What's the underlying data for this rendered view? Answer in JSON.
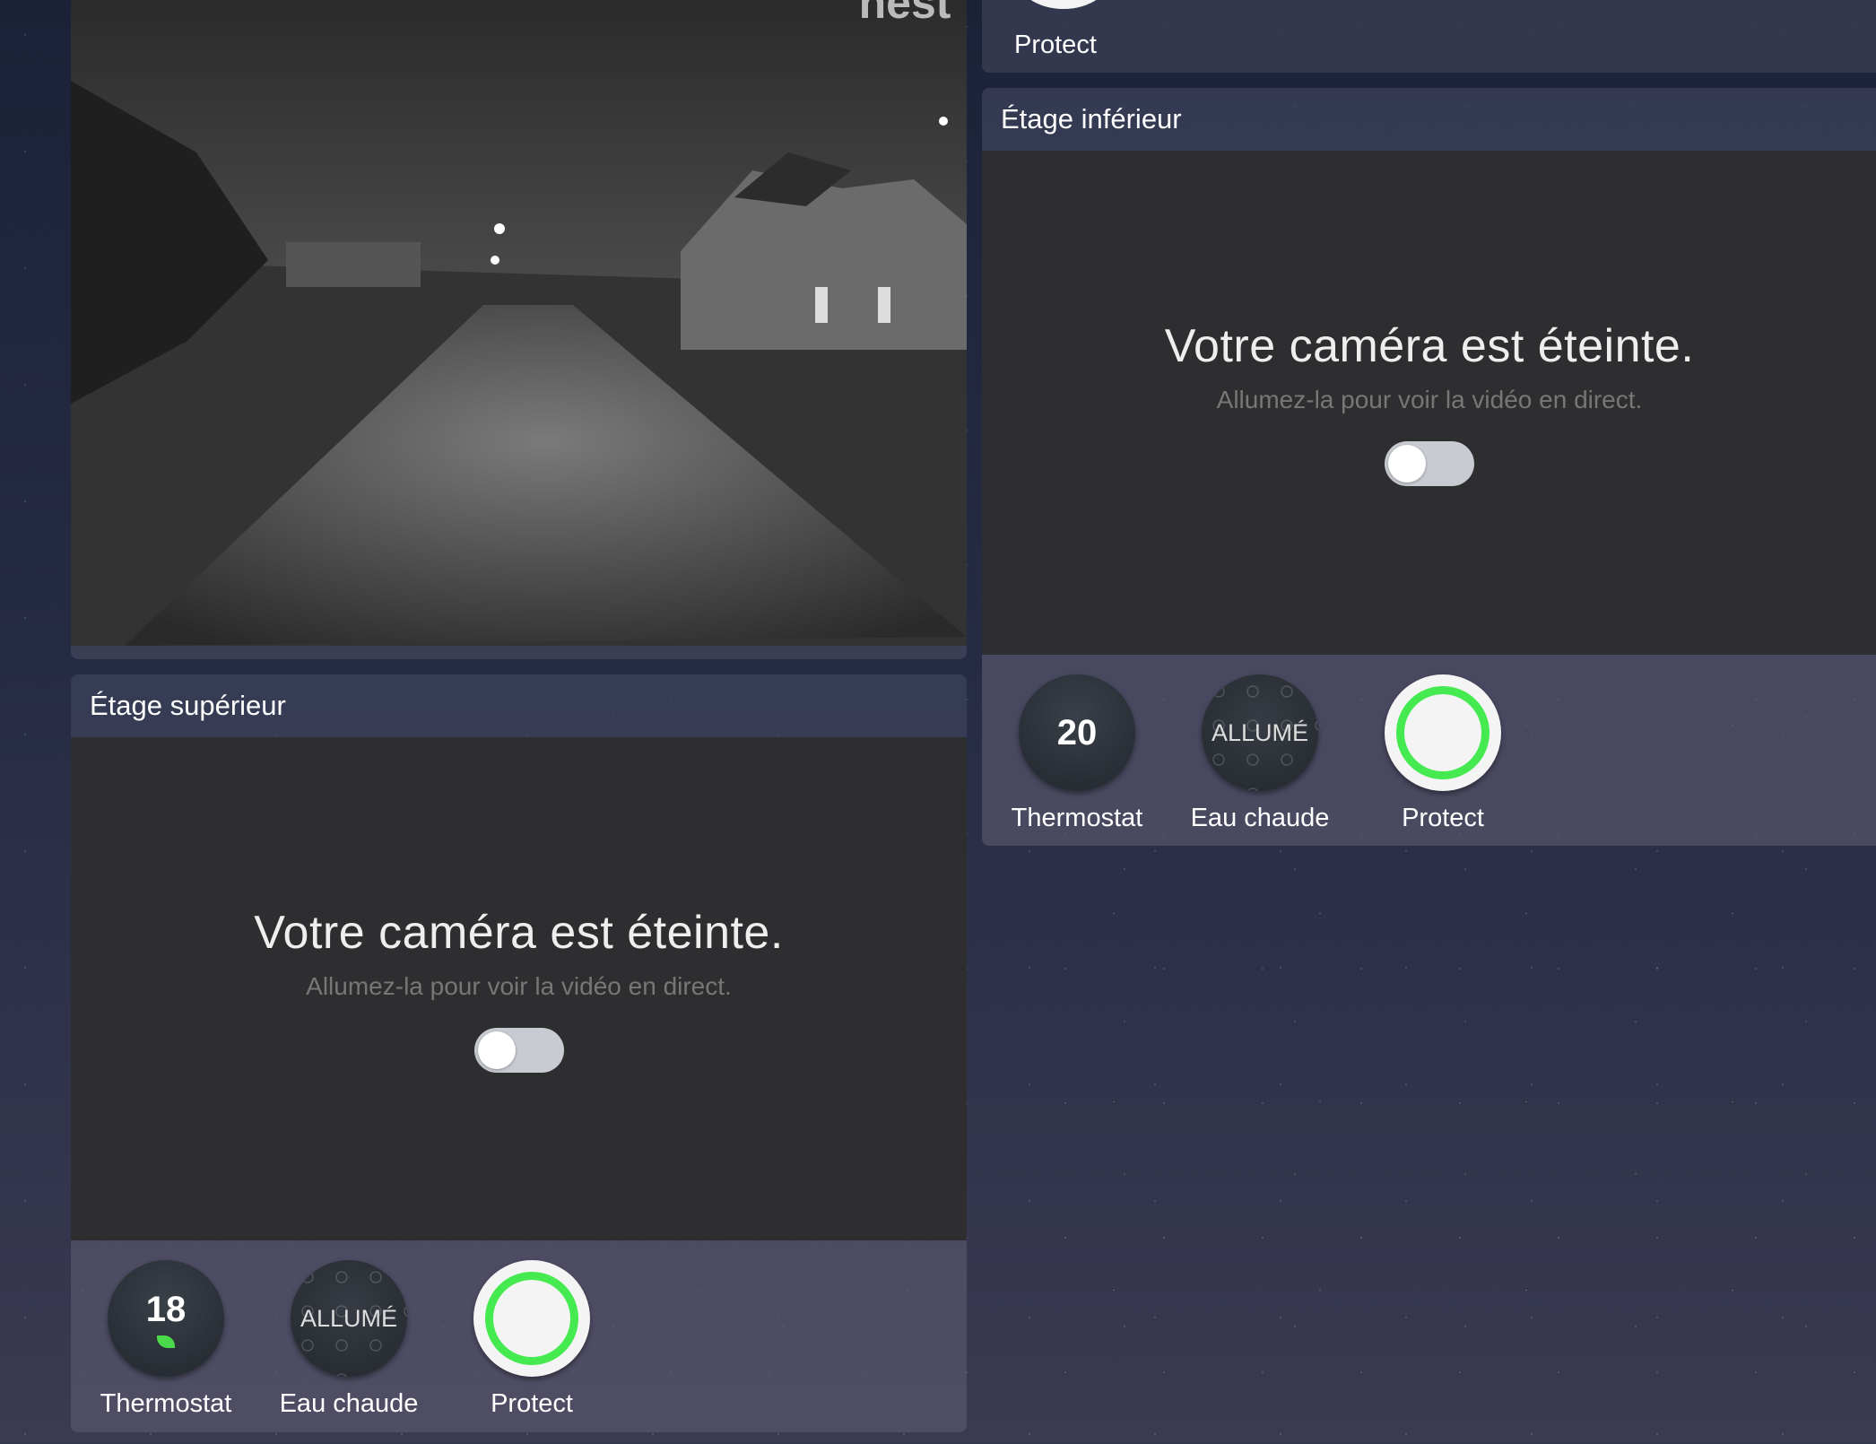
{
  "camera_feed": {
    "logo": "nest"
  },
  "top_right_card": {
    "device_label": "Protect"
  },
  "cameras": [
    {
      "name": "Étage supérieur",
      "off_title": "Votre caméra est éteinte.",
      "off_subtitle": "Allumez-la pour voir la vidéo en direct.",
      "toggle_on": false,
      "devices": [
        {
          "type": "thermostat",
          "value": "18",
          "eco_leaf": true,
          "label": "Thermostat"
        },
        {
          "type": "hot-water",
          "value": "ALLUMÉ",
          "label": "Eau chaude"
        },
        {
          "type": "protect",
          "label": "Protect",
          "status_color": "#44ea4f"
        }
      ]
    },
    {
      "name": "Étage inférieur",
      "off_title": "Votre caméra est éteinte.",
      "off_subtitle": "Allumez-la pour voir la vidéo en direct.",
      "toggle_on": false,
      "devices": [
        {
          "type": "thermostat",
          "value": "20",
          "label": "Thermostat"
        },
        {
          "type": "hot-water",
          "value": "ALLUMÉ",
          "label": "Eau chaude"
        },
        {
          "type": "protect",
          "label": "Protect",
          "status_color": "#44ea4f"
        }
      ]
    }
  ]
}
